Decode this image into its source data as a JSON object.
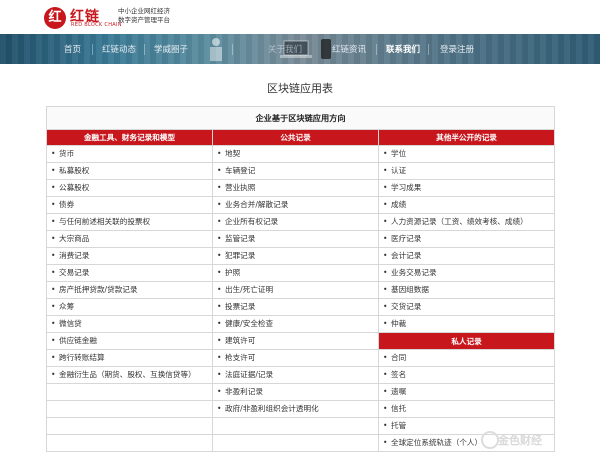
{
  "header": {
    "logo_char": "红",
    "brand": "红链",
    "brand_sub": "RED BLOCK CHAIN",
    "tagline_1": "中小企业网红经济",
    "tagline_2": "数字资产管理平台"
  },
  "nav": [
    {
      "label": "首页",
      "selected": false
    },
    {
      "label": "红链动态",
      "selected": false
    },
    {
      "label": "学威圈子",
      "selected": false
    },
    {
      "label": "关于我们",
      "selected": false
    },
    {
      "label": "红链资讯",
      "selected": false
    },
    {
      "label": "联系我们",
      "selected": true
    },
    {
      "label": "登录注册",
      "selected": false
    }
  ],
  "page_title": "区块链应用表",
  "table": {
    "main_header": "企业基于区块链应用方向",
    "col_headers": [
      "金融工具、财务记录和模型",
      "公共记录",
      "其他半公开的记录"
    ],
    "rows": [
      [
        "货币",
        "地契",
        "学位"
      ],
      [
        "私募股权",
        "车辆登记",
        "认证"
      ],
      [
        "公募股权",
        "营业执照",
        "学习成果"
      ],
      [
        "债券",
        "业务合并/解散记录",
        "成绩"
      ],
      [
        "与任何前述相关联的投票权",
        "企业所有权记录",
        "人力资源记录（工资、绩效考核、成绩）"
      ],
      [
        "大宗商品",
        "监管记录",
        "医疗记录"
      ],
      [
        "消费记录",
        "犯罪记录",
        "会计记录"
      ],
      [
        "交易记录",
        "护照",
        "业务交易记录"
      ],
      [
        "房产抵押贷款/贷款记录",
        "出生/死亡证明",
        "基因组数据"
      ],
      [
        "众筹",
        "投票记录",
        "交货记录"
      ],
      [
        "微信贷",
        "健康/安全检查",
        "仲裁"
      ],
      [
        "供应链金融",
        "建筑许可",
        ""
      ],
      [
        "跨行转账结算",
        "枪支许可",
        "合同"
      ],
      [
        "金融衍生品（期货、股权、互换信贷等）",
        "法庭证据/记录",
        "签名"
      ],
      [
        "",
        "非盈利记录",
        "遗嘱"
      ],
      [
        "",
        "政府/非盈利组织会计透明化",
        "信托"
      ],
      [
        "",
        "",
        "托管"
      ],
      [
        "",
        "",
        "全球定位系统轨迹（个人）"
      ]
    ],
    "sub_header": "私人记录"
  },
  "watermark": "金色财经"
}
